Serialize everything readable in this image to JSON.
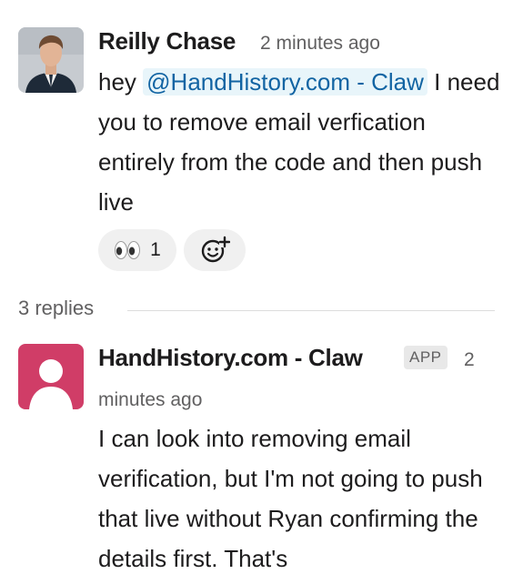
{
  "messages": [
    {
      "author": "Reilly Chase",
      "time": "2 minutes ago",
      "text_before": "hey ",
      "mention": "@HandHistory.com - Claw",
      "text_after": " I need you to remove email verfication entirely from the code and then push live",
      "reactions": [
        {
          "emoji": "eyes",
          "count": "1"
        },
        {
          "emoji": "add-reaction",
          "count": ""
        }
      ]
    },
    {
      "author": "HandHistory.com - Claw",
      "badge": "APP",
      "time_line1": "2",
      "time_line2": "minutes ago",
      "text": "I can look into removing email verification, but I'm not going to push that live without Ryan confirming the details first. That's"
    }
  ],
  "thread": {
    "replies_label": "3 replies"
  }
}
